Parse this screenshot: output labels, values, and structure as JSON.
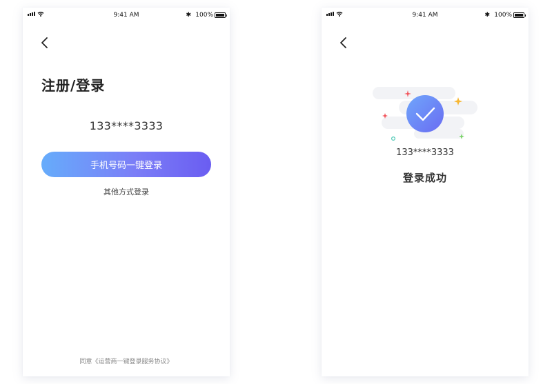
{
  "screens": [
    {
      "status_bar": {
        "time": "9:41 AM",
        "bluetooth": "✱",
        "battery_text": "100%"
      },
      "back_icon": "chevron-left-icon",
      "title": "注册/登录",
      "masked_phone": "133****3333",
      "primary_button": "手机号码一键登录",
      "secondary_link": "其他方式登录",
      "agreement": "同意《运营商一键登录服务协议》"
    },
    {
      "status_bar": {
        "time": "9:41 AM",
        "bluetooth": "✱",
        "battery_text": "100%"
      },
      "back_icon": "chevron-left-icon",
      "success_icon": "check-circle-icon",
      "masked_phone": "133****3333",
      "status_text": "登录成功"
    }
  ],
  "colors": {
    "button_gradient_start": "#66acfb",
    "button_gradient_end": "#6a5df1",
    "check_circle_start": "#6fa6fb",
    "check_circle_end": "#6a6cf2",
    "sparkle_red": "#f2545b",
    "sparkle_yellow": "#f7b733",
    "sparkle_green": "#7bd36a",
    "ring_teal": "#4fc9b5"
  }
}
